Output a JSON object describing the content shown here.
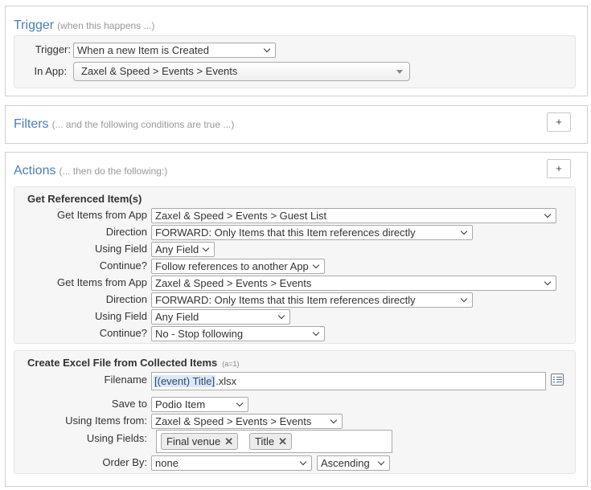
{
  "trigger": {
    "title": "Trigger",
    "subtitle": "(when this happens ...)",
    "trigger_label": "Trigger:",
    "trigger_value": "When a new Item is Created",
    "app_label": "In App:",
    "app_value": "Zaxel & Speed > Events > Events"
  },
  "filters": {
    "title": "Filters",
    "subtitle": "(... and the following conditions are true ...)",
    "add_label": "+"
  },
  "actions": {
    "title": "Actions",
    "subtitle": "(... then do the following:)",
    "add_label": "+",
    "get_referenced": {
      "title": "Get Referenced Item(s)",
      "rows": [
        {
          "label": "Get Items from App",
          "value": "Zaxel & Speed > Events > Guest List"
        },
        {
          "label": "Direction",
          "value": "FORWARD: Only Items that this Item references directly"
        },
        {
          "label": "Using Field",
          "value": "Any Field"
        },
        {
          "label": "Continue?",
          "value": "Follow references to another App"
        },
        {
          "label": "Get Items from App",
          "value": "Zaxel & Speed > Events > Events"
        },
        {
          "label": "Direction",
          "value": "FORWARD: Only Items that this Item references directly"
        },
        {
          "label": "Using Field",
          "value": "Any Field"
        },
        {
          "label": "Continue?",
          "value": "No - Stop following"
        }
      ]
    },
    "create_excel": {
      "title": "Create Excel File from Collected Items",
      "subtitle": "(a=1)",
      "filename_label": "Filename",
      "filename_token": "[(event) Title]",
      "filename_suffix": ".xlsx",
      "save_to_label": "Save to",
      "save_to_value": "Podio Item",
      "using_items_label": "Using Items from:",
      "using_items_value": "Zaxel & Speed > Events > Events",
      "using_fields_label": "Using Fields:",
      "fields": [
        "Final venue",
        "Title"
      ],
      "remove_glyph": "✕",
      "order_by_label": "Order By:",
      "order_by_value": "none",
      "order_dir_value": "Ascending"
    }
  }
}
